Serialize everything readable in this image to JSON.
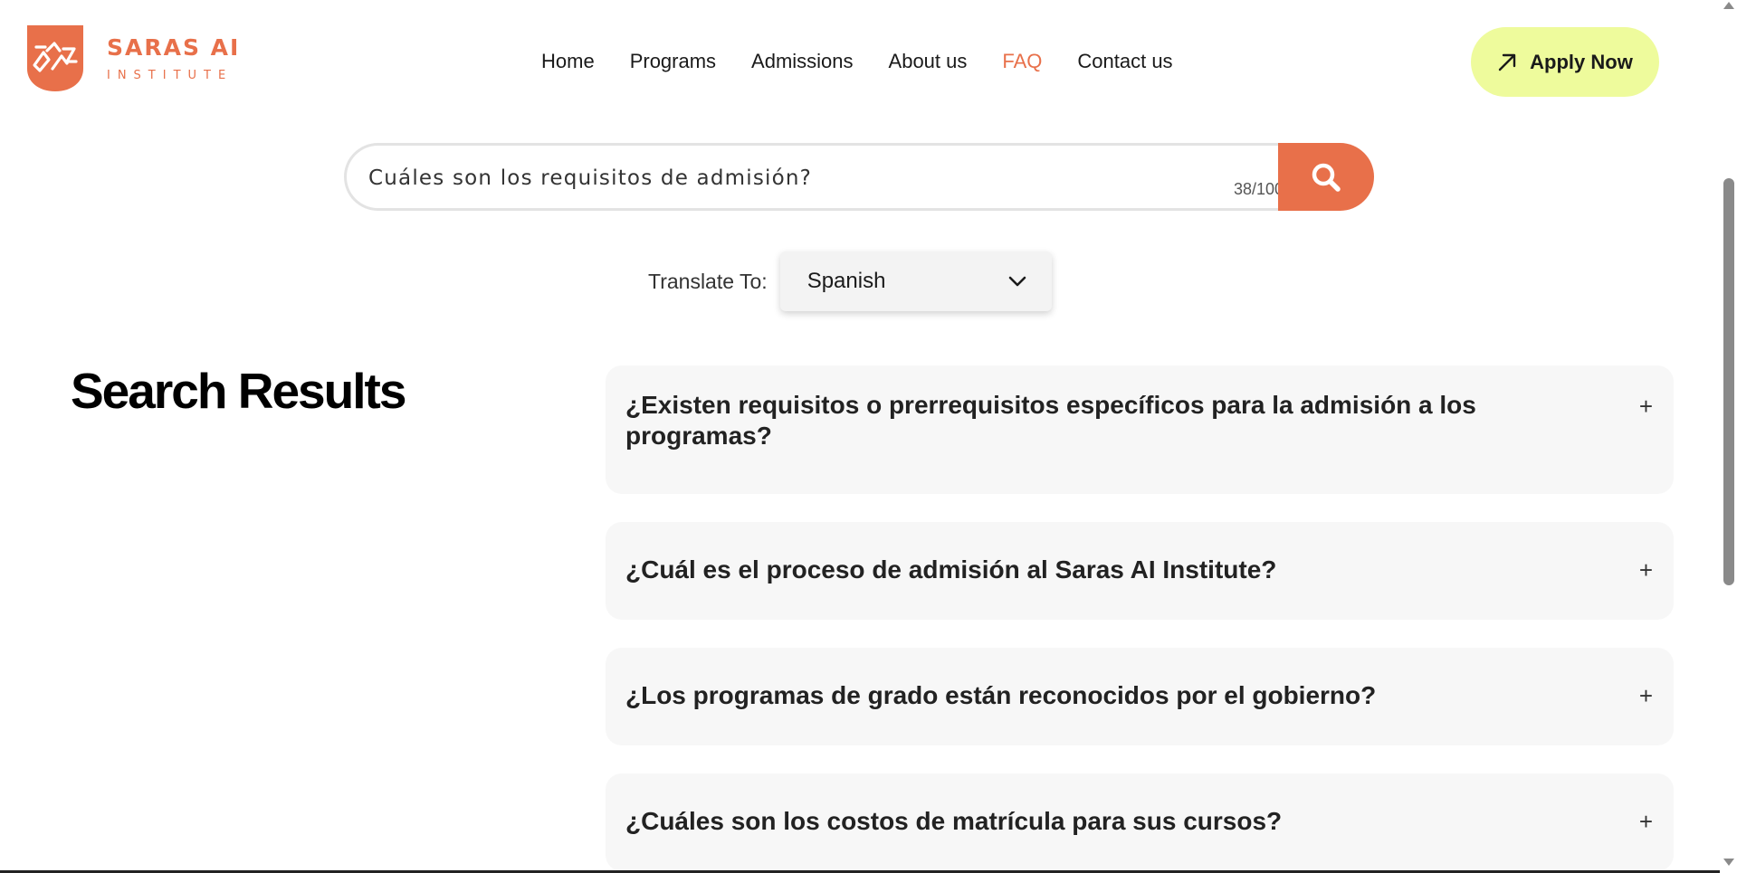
{
  "brand": {
    "name": "SARAS AI",
    "tagline": "INSTITUTE",
    "accent_color": "#e8704a",
    "cta_color": "#eefb9c"
  },
  "nav": {
    "items": [
      "Home",
      "Programs",
      "Admissions",
      "About us",
      "FAQ",
      "Contact us"
    ],
    "active": "FAQ"
  },
  "apply": {
    "label": "Apply Now",
    "icon": "arrow-up-right-icon"
  },
  "search": {
    "value": "Cuáles son los requisitos de admisión?",
    "char_count": "38/100",
    "icon": "search-icon"
  },
  "translate": {
    "label": "Translate To:",
    "selected": "Spanish",
    "icon": "chevron-down-icon"
  },
  "results": {
    "title": "Search Results",
    "items": [
      {
        "question": "¿Existen requisitos o prerrequisitos específicos para la admisión a los programas?",
        "toggle": "+"
      },
      {
        "question": "¿Cuál es el proceso de admisión al Saras AI Institute?",
        "toggle": "+"
      },
      {
        "question": "¿Los programas de grado están reconocidos por el gobierno?",
        "toggle": "+"
      },
      {
        "question": "¿Cuáles son los costos de matrícula para sus cursos?",
        "toggle": "+"
      }
    ]
  }
}
